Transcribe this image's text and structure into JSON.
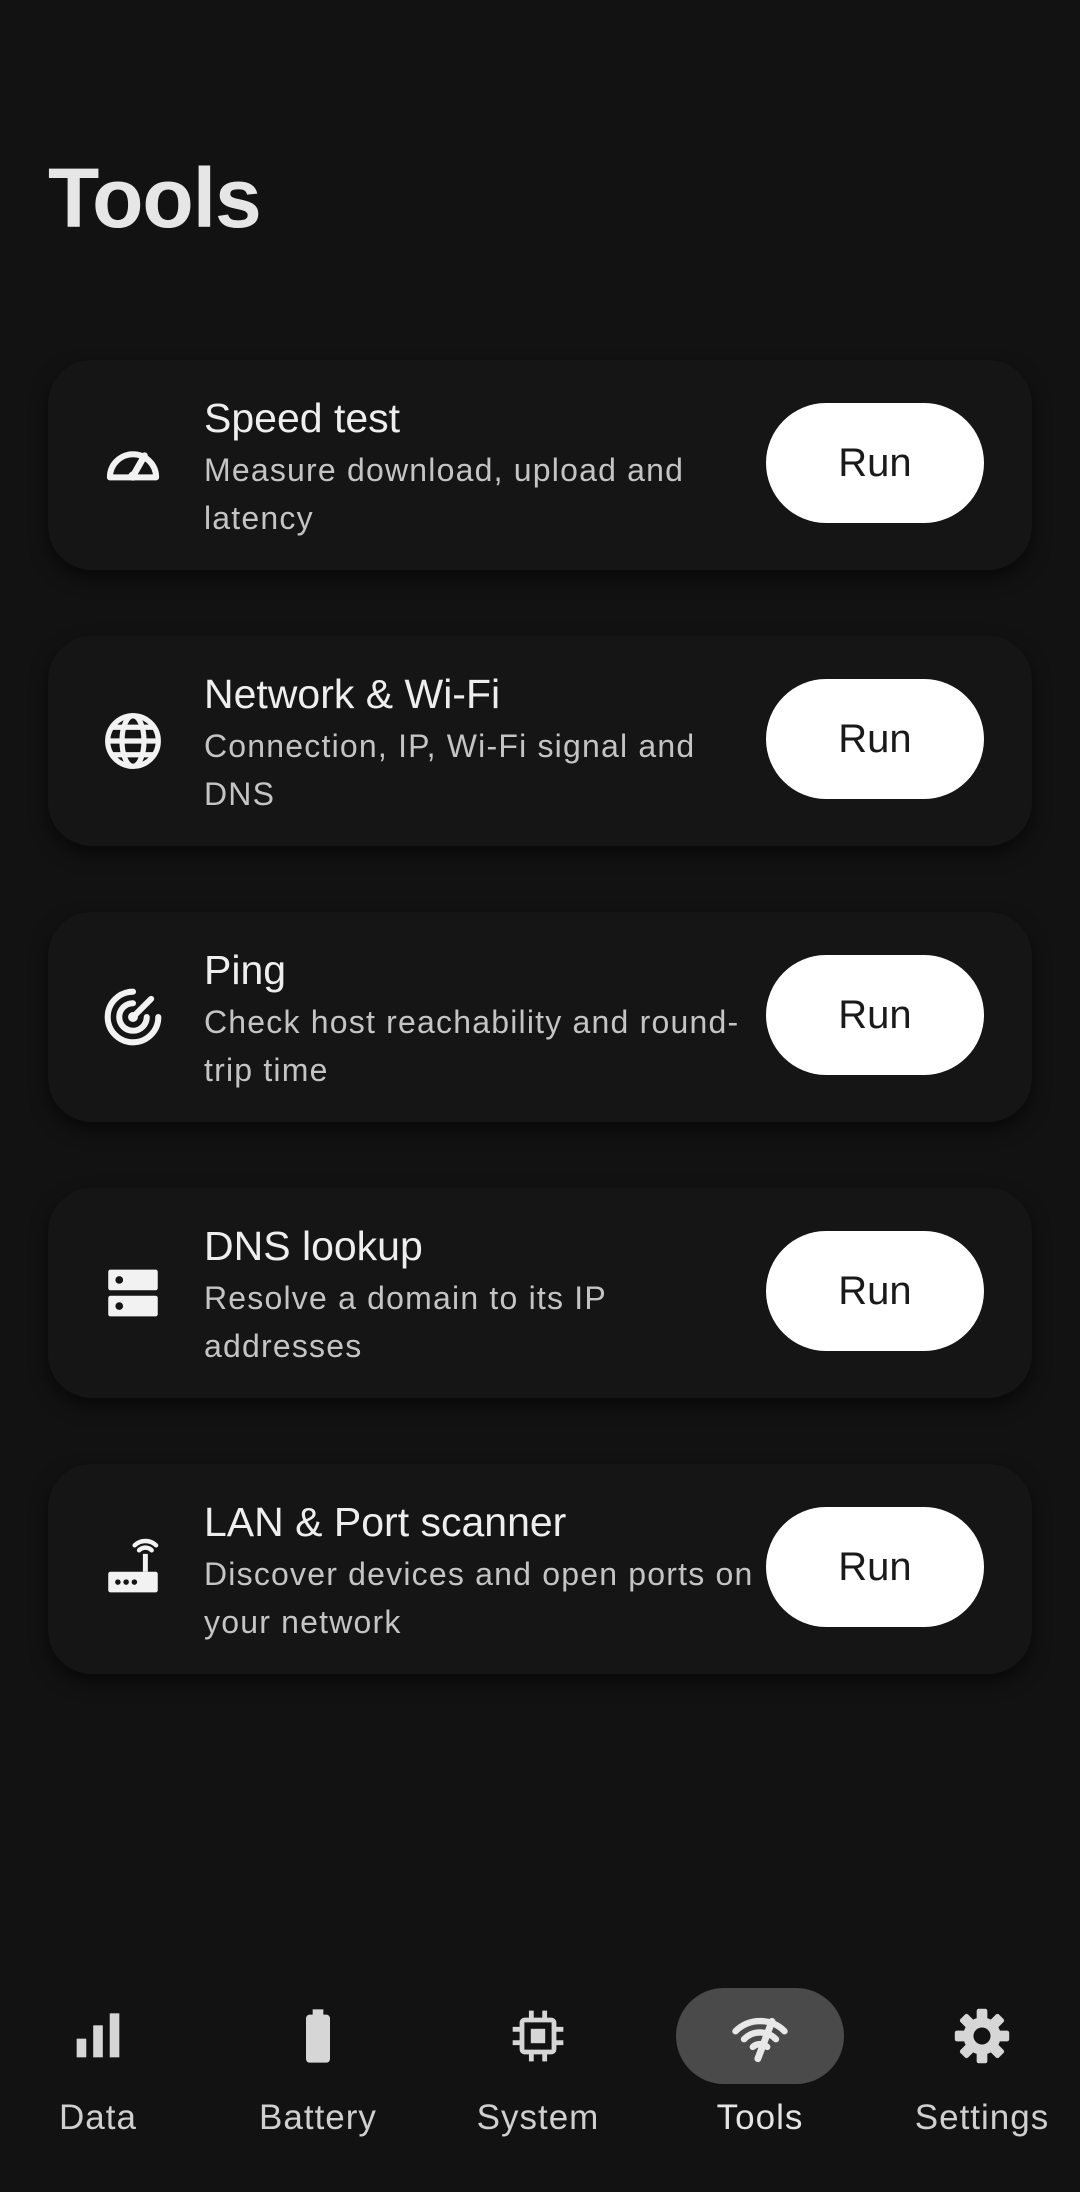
{
  "header": {
    "title": "Tools"
  },
  "tools": [
    {
      "title": "Speed test",
      "description": "Measure download, upload and latency",
      "icon": "speedometer-icon",
      "action_label": "Run"
    },
    {
      "title": "Network & Wi-Fi",
      "description": "Connection, IP, Wi-Fi signal and DNS",
      "icon": "globe-icon",
      "action_label": "Run"
    },
    {
      "title": "Ping",
      "description": "Check host reachability and round-trip time",
      "icon": "radar-icon",
      "action_label": "Run"
    },
    {
      "title": "DNS lookup",
      "description": "Resolve a domain to its IP addresses",
      "icon": "server-icon",
      "action_label": "Run"
    },
    {
      "title": "LAN & Port scanner",
      "description": "Discover devices and open ports on your network",
      "icon": "router-icon",
      "action_label": "Run"
    }
  ],
  "nav": {
    "active": "Tools",
    "items": [
      {
        "label": "Data",
        "icon": "bar-chart-icon"
      },
      {
        "label": "Battery",
        "icon": "battery-icon"
      },
      {
        "label": "System",
        "icon": "chip-icon"
      },
      {
        "label": "Tools",
        "icon": "wifi-tools-icon"
      },
      {
        "label": "Settings",
        "icon": "gear-icon"
      }
    ]
  },
  "colors": {
    "background": "#121212",
    "card": "#151515",
    "button": "#ffffff",
    "active_pill": "#4a4a4a"
  }
}
